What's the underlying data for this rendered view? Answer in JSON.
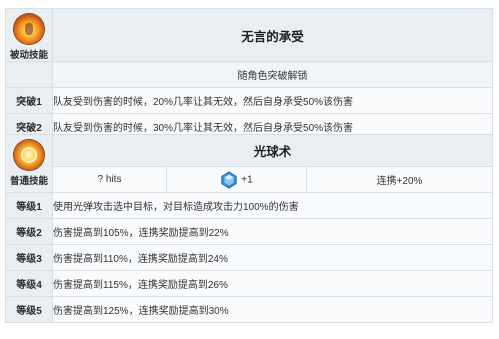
{
  "passive": {
    "icon": "flame-orb-icon",
    "type_label": "被动技能",
    "name": "无言的承受",
    "unlock": "随角色突破解锁",
    "rows": [
      {
        "label": "突破1",
        "desc": "队友受到伤害的时候，20%几率让其无效，然后自身承受50%该伤害"
      },
      {
        "label": "突破2",
        "desc": "队友受到伤害的时候，30%几率让其无效，然后自身承受50%该伤害"
      }
    ]
  },
  "normal": {
    "icon": "light-orb-icon",
    "type_label": "普通技能",
    "name": "光球术",
    "hits": "? hits",
    "gem_icon": "blue-gem-icon",
    "gem_value": "+1",
    "combo": "连携+20%",
    "levels": [
      {
        "label": "等级1",
        "desc": "使用光弹攻击选中目标，对目标造成攻击力100%的伤害"
      },
      {
        "label": "等级2",
        "desc": "伤害提高到105%，连携奖励提高到22%"
      },
      {
        "label": "等级3",
        "desc": "伤害提高到110%，连携奖励提高到24%"
      },
      {
        "label": "等级4",
        "desc": "伤害提高到115%，连携奖励提高到26%"
      },
      {
        "label": "等级5",
        "desc": "伤害提高到125%，连携奖励提高到30%"
      }
    ]
  },
  "colors": {
    "header_bg": "#e9eef3",
    "cell_bg": "#f9fafb",
    "border": "#d9dee4",
    "gem_blue": "#3d8fd6"
  }
}
